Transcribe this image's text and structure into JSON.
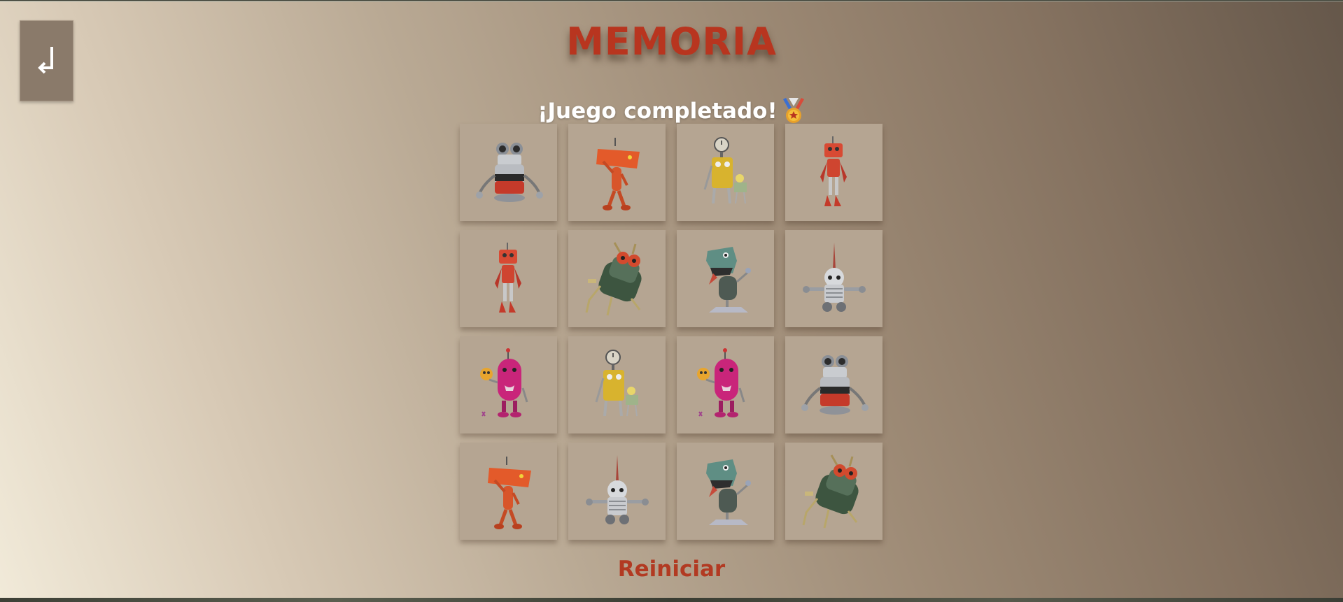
{
  "header": {
    "title": "MEMORIA",
    "back_icon": "return-arrow-icon"
  },
  "status": {
    "text": "¡Juego completado!",
    "icon": "medal-icon"
  },
  "board": {
    "rows": 4,
    "columns": 4,
    "cards": [
      {
        "robot": "silver-barrel-robot"
      },
      {
        "robot": "orange-tv-head-robot"
      },
      {
        "robot": "yellow-clock-robot"
      },
      {
        "robot": "red-thin-robot"
      },
      {
        "robot": "red-thin-robot"
      },
      {
        "robot": "green-beetle-robot"
      },
      {
        "robot": "teal-dino-robot"
      },
      {
        "robot": "silver-spike-robot"
      },
      {
        "robot": "pink-capsule-robot"
      },
      {
        "robot": "yellow-clock-robot"
      },
      {
        "robot": "pink-capsule-robot"
      },
      {
        "robot": "silver-barrel-robot"
      },
      {
        "robot": "orange-tv-head-robot"
      },
      {
        "robot": "silver-spike-robot"
      },
      {
        "robot": "teal-dino-robot"
      },
      {
        "robot": "green-beetle-robot"
      }
    ]
  },
  "footer": {
    "restart_label": "Reiniciar"
  },
  "colors": {
    "title": "#b8351f",
    "restart": "#b23a22",
    "card": "#b5a592",
    "back_button": "#8a7a6a"
  }
}
